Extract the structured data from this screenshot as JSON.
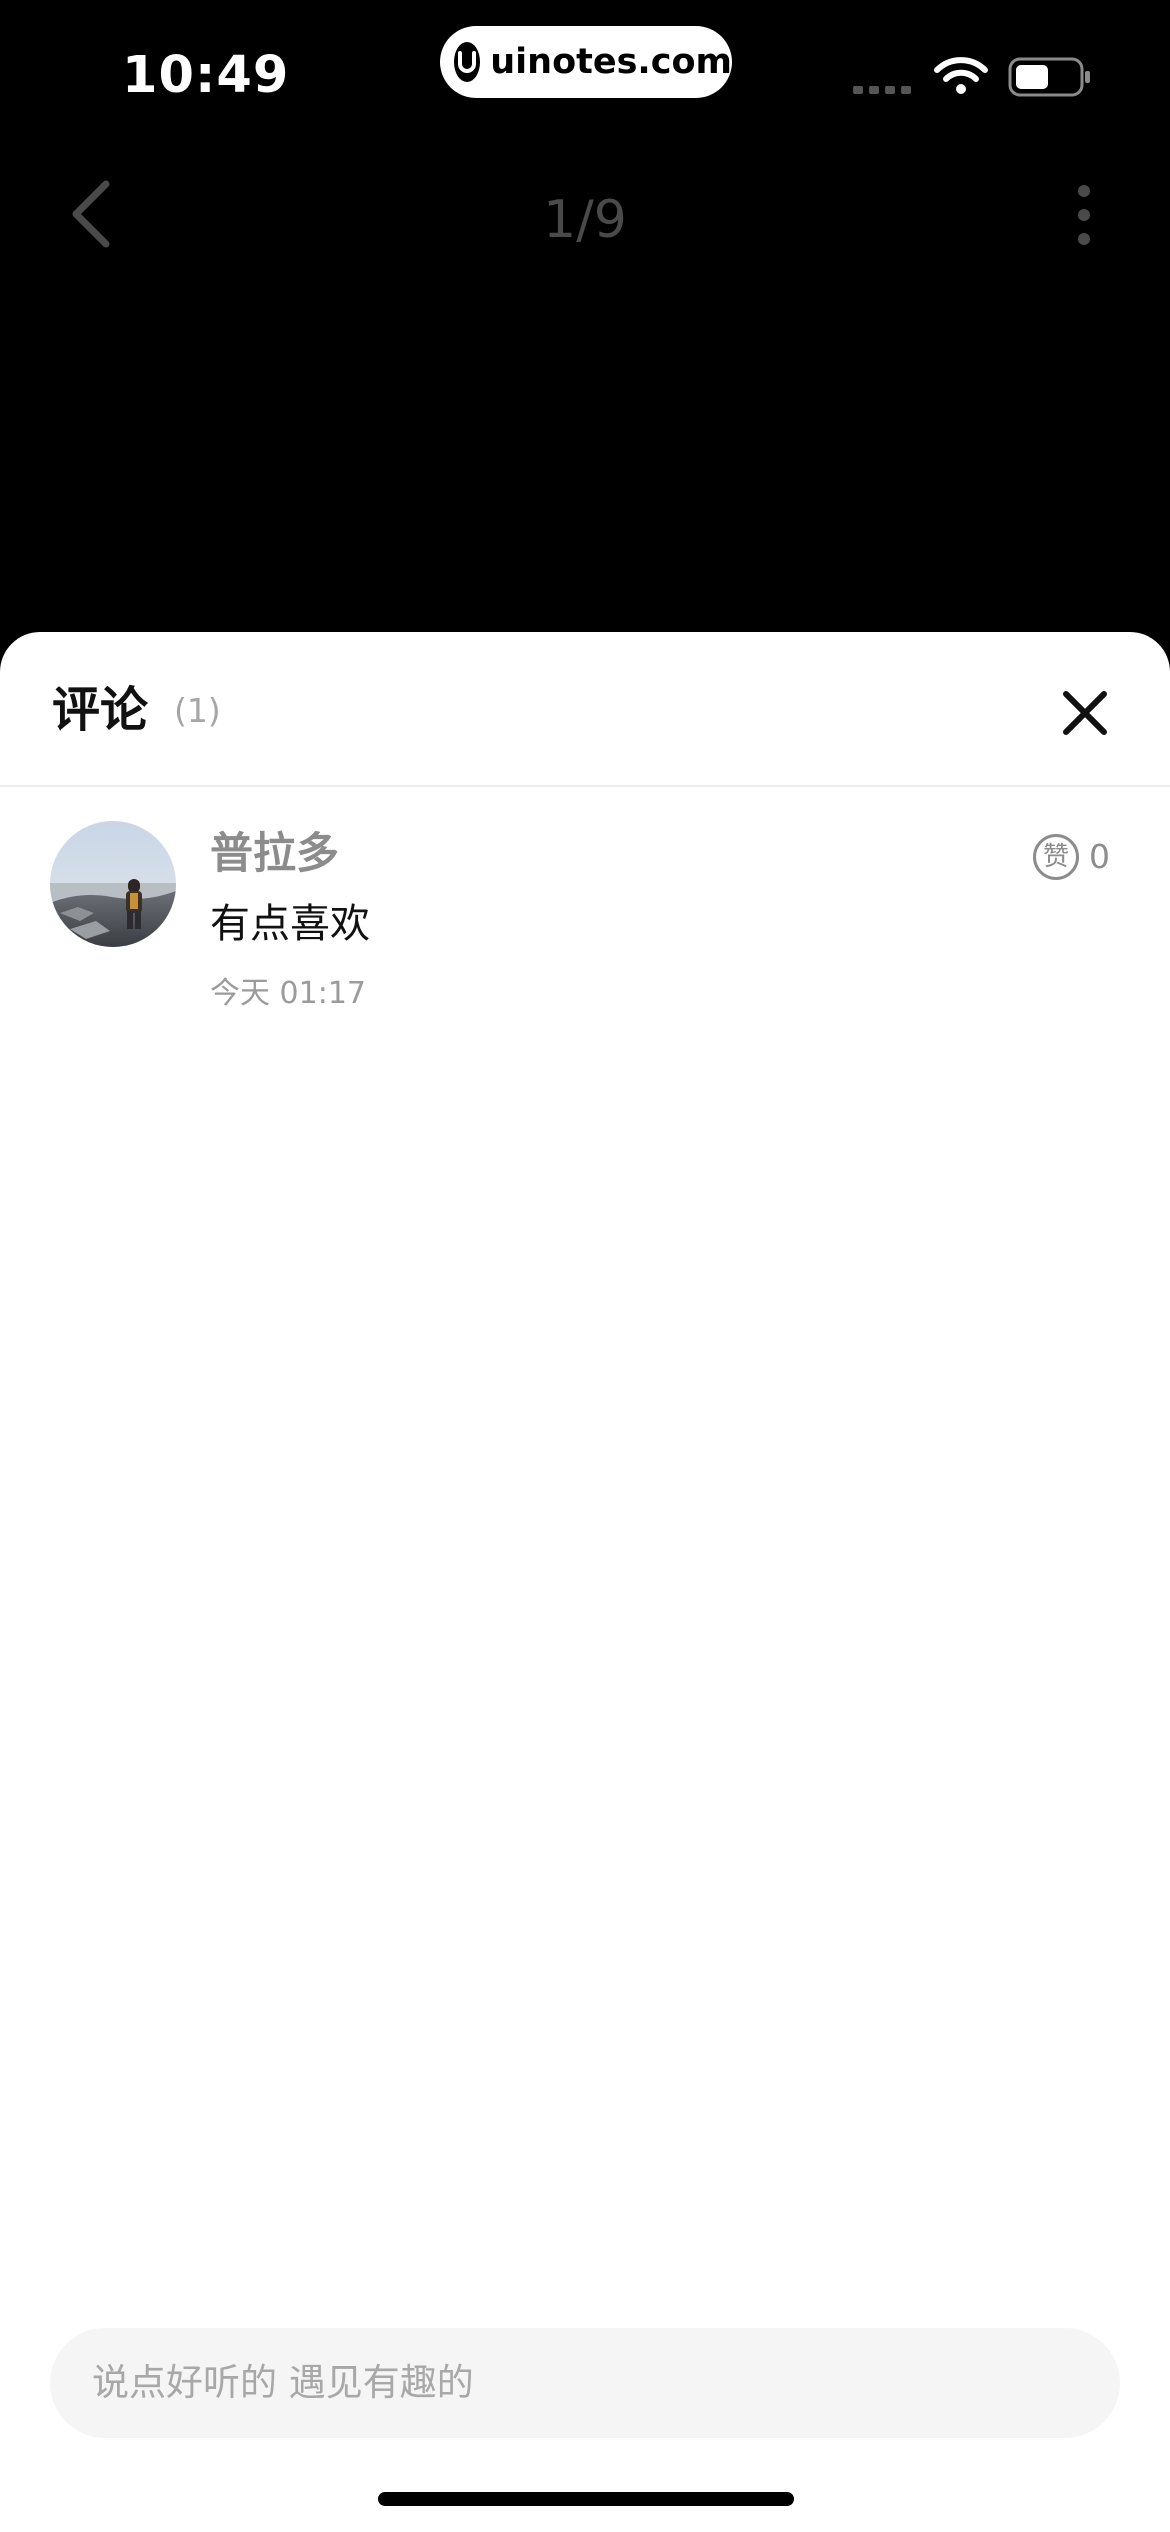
{
  "status_bar": {
    "time": "10:49",
    "watermark": "uinotes.com"
  },
  "viewer": {
    "page_counter": "1/9"
  },
  "comments_sheet": {
    "title": "评论",
    "count": "(1)",
    "comments": [
      {
        "author": "普拉多",
        "text": "有点喜欢",
        "time": "今天 01:17",
        "like_icon_label": "赞",
        "likes": "0"
      }
    ],
    "input_placeholder": "说点好听的 遇见有趣的"
  },
  "colors": {
    "background": "#000000",
    "sheet": "#ffffff",
    "secondary_text": "#8c8c8c",
    "input_background": "#f5f5f5"
  },
  "icons": {
    "back": "chevron-left-icon",
    "more": "more-vertical-icon",
    "close": "close-icon",
    "like": "like-icon",
    "wifi": "wifi-icon",
    "battery": "battery-icon",
    "signal": "cell-signal-icon"
  }
}
